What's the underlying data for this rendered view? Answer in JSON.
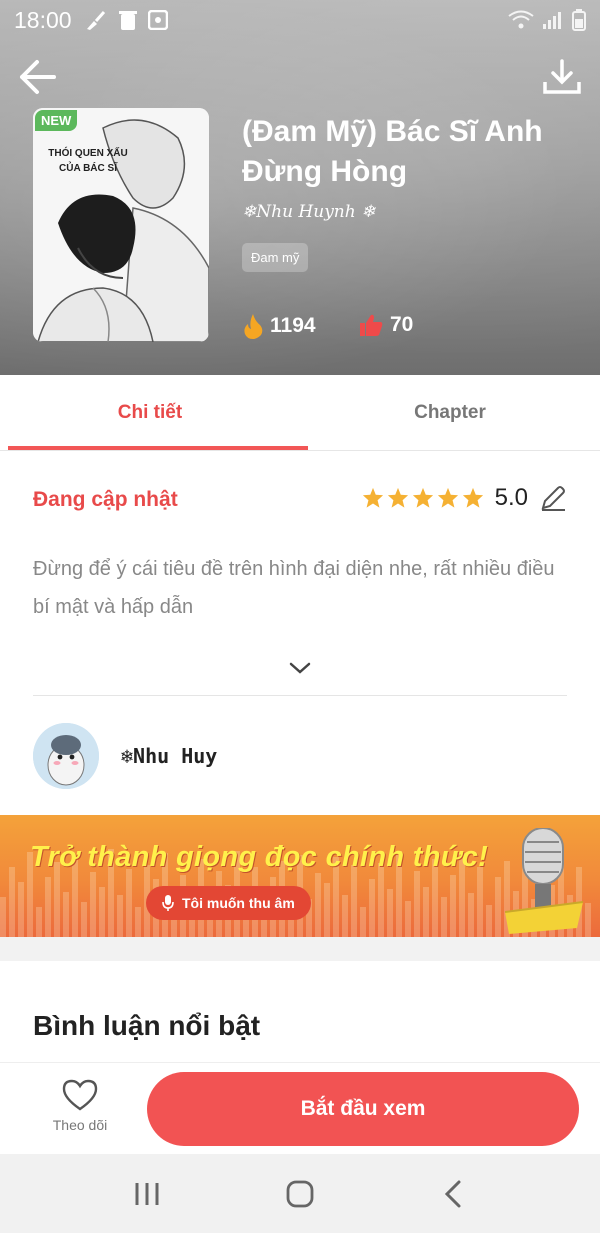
{
  "status_bar": {
    "time": "18:00"
  },
  "header": {
    "badge": "NEW",
    "cover_text": "THÓI QUEN XẤU CỦA BÁC SĨ",
    "title": "(Đam Mỹ) Bác Sĩ Anh Đừng Hòng",
    "author": "❄Nhu Huynh ❄",
    "genre": "Đam mỹ",
    "views": "1194",
    "likes": "70"
  },
  "tabs": [
    {
      "label": "Chi tiết",
      "active": true
    },
    {
      "label": "Chapter",
      "active": false
    }
  ],
  "detail": {
    "status": "Đang cập nhật",
    "rating": "5.0",
    "stars": 5,
    "description": "Đừng để ý cái tiêu đề trên hình đại diện nhe, rất nhiều điều bí mật và hấp dẫn"
  },
  "uploader": {
    "name": "❄Nhu Huy"
  },
  "banner": {
    "title": "Trở thành giọng đọc chính thức!",
    "button_label": "Tôi muốn thu âm"
  },
  "comments": {
    "title": "Bình luận nổi bật"
  },
  "actions": {
    "follow_label": "Theo dõi",
    "start_label": "Bắt đầu xem"
  },
  "colors": {
    "accent": "#f25353",
    "active_tab": "#e84a4a",
    "star": "#f5b133",
    "banner": "#f1893b"
  }
}
